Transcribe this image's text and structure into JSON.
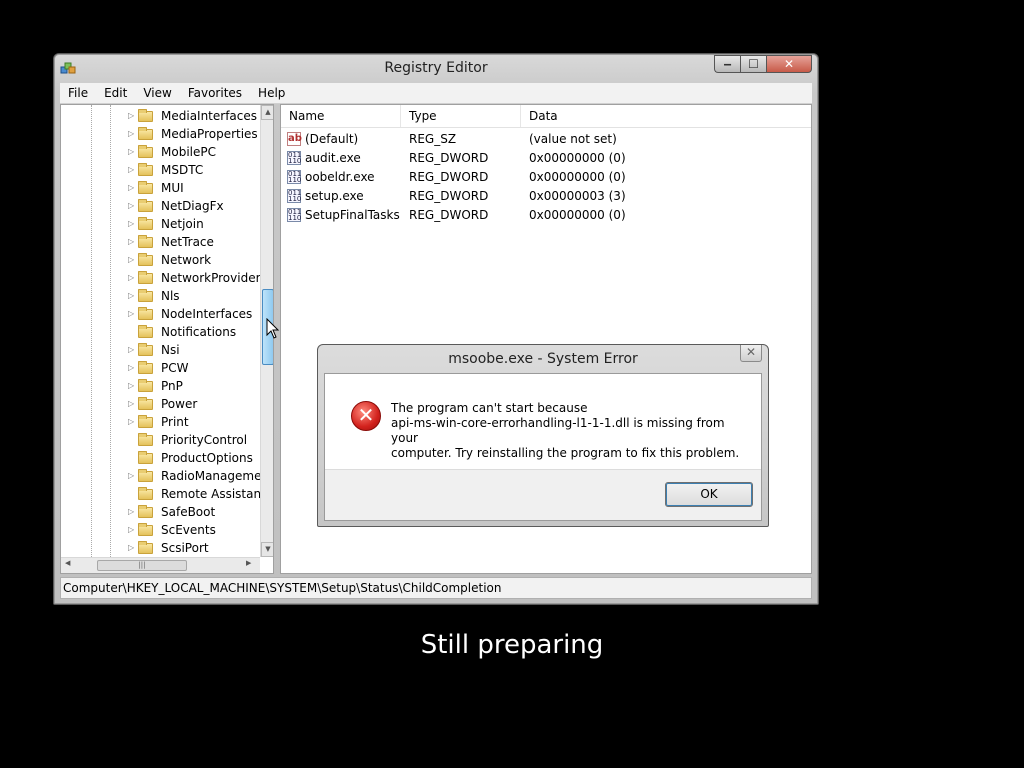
{
  "window": {
    "title": "Registry Editor",
    "menu": [
      "File",
      "Edit",
      "View",
      "Favorites",
      "Help"
    ],
    "caption_buttons": {
      "minimize": "‒",
      "maximize": "☐",
      "close": "✕"
    }
  },
  "tree": {
    "items": [
      {
        "label": "MediaInterfaces",
        "expandable": true
      },
      {
        "label": "MediaProperties",
        "expandable": true
      },
      {
        "label": "MobilePC",
        "expandable": true
      },
      {
        "label": "MSDTC",
        "expandable": true
      },
      {
        "label": "MUI",
        "expandable": true
      },
      {
        "label": "NetDiagFx",
        "expandable": true
      },
      {
        "label": "Netjoin",
        "expandable": true
      },
      {
        "label": "NetTrace",
        "expandable": true
      },
      {
        "label": "Network",
        "expandable": true
      },
      {
        "label": "NetworkProvider",
        "expandable": true
      },
      {
        "label": "Nls",
        "expandable": true
      },
      {
        "label": "NodeInterfaces",
        "expandable": true
      },
      {
        "label": "Notifications",
        "expandable": false
      },
      {
        "label": "Nsi",
        "expandable": true
      },
      {
        "label": "PCW",
        "expandable": true
      },
      {
        "label": "PnP",
        "expandable": true
      },
      {
        "label": "Power",
        "expandable": true
      },
      {
        "label": "Print",
        "expandable": true
      },
      {
        "label": "PriorityControl",
        "expandable": false
      },
      {
        "label": "ProductOptions",
        "expandable": false
      },
      {
        "label": "RadioManagemen",
        "expandable": true
      },
      {
        "label": "Remote Assistance",
        "expandable": false
      },
      {
        "label": "SafeBoot",
        "expandable": true
      },
      {
        "label": "ScEvents",
        "expandable": true
      },
      {
        "label": "ScsiPort",
        "expandable": true
      }
    ]
  },
  "values_list": {
    "columns": [
      "Name",
      "Type",
      "Data"
    ],
    "rows": [
      {
        "icon": "string-value-icon",
        "name": "(Default)",
        "type": "REG_SZ",
        "data": "(value not set)"
      },
      {
        "icon": "dword-value-icon",
        "name": "audit.exe",
        "type": "REG_DWORD",
        "data": "0x00000000 (0)"
      },
      {
        "icon": "dword-value-icon",
        "name": "oobeldr.exe",
        "type": "REG_DWORD",
        "data": "0x00000000 (0)"
      },
      {
        "icon": "dword-value-icon",
        "name": "setup.exe",
        "type": "REG_DWORD",
        "data": "0x00000003 (3)"
      },
      {
        "icon": "dword-value-icon",
        "name": "SetupFinalTasks",
        "type": "REG_DWORD",
        "data": "0x00000000 (0)"
      }
    ]
  },
  "status_bar": {
    "path": "Computer\\HKEY_LOCAL_MACHINE\\SYSTEM\\Setup\\Status\\ChildCompletion"
  },
  "dialog": {
    "title": "msoobe.exe - System Error",
    "message_lines": [
      "The program can't start because",
      "api-ms-win-core-errorhandling-l1-1-1.dll is missing from your",
      "computer. Try reinstalling the program to fix this problem."
    ],
    "ok_label": "OK",
    "close_glyph": "✕"
  },
  "caption": "Still preparing",
  "colors": {
    "background": "#000000",
    "error_red": "#d2221d",
    "focus_blue": "#3c7fb1"
  }
}
